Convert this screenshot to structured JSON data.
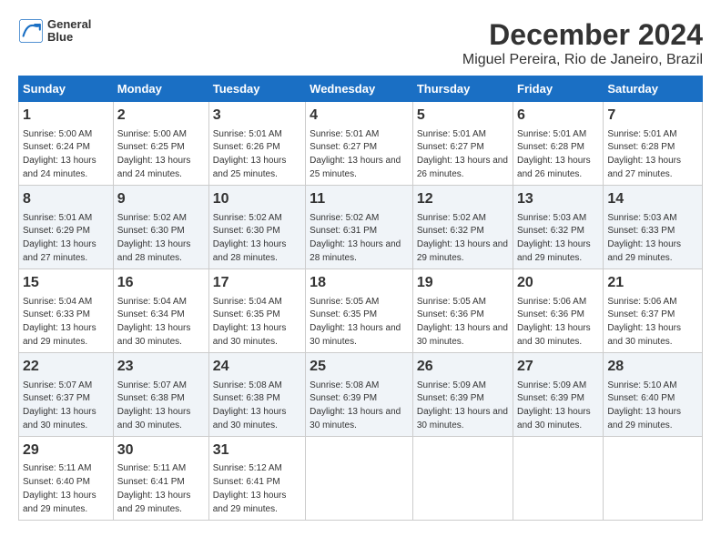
{
  "logo": {
    "line1": "General",
    "line2": "Blue"
  },
  "title": "December 2024",
  "subtitle": "Miguel Pereira, Rio de Janeiro, Brazil",
  "days_header": [
    "Sunday",
    "Monday",
    "Tuesday",
    "Wednesday",
    "Thursday",
    "Friday",
    "Saturday"
  ],
  "weeks": [
    [
      {
        "day": "1",
        "sunrise": "5:00 AM",
        "sunset": "6:24 PM",
        "daylight": "13 hours and 24 minutes."
      },
      {
        "day": "2",
        "sunrise": "5:00 AM",
        "sunset": "6:25 PM",
        "daylight": "13 hours and 24 minutes."
      },
      {
        "day": "3",
        "sunrise": "5:01 AM",
        "sunset": "6:26 PM",
        "daylight": "13 hours and 25 minutes."
      },
      {
        "day": "4",
        "sunrise": "5:01 AM",
        "sunset": "6:27 PM",
        "daylight": "13 hours and 25 minutes."
      },
      {
        "day": "5",
        "sunrise": "5:01 AM",
        "sunset": "6:27 PM",
        "daylight": "13 hours and 26 minutes."
      },
      {
        "day": "6",
        "sunrise": "5:01 AM",
        "sunset": "6:28 PM",
        "daylight": "13 hours and 26 minutes."
      },
      {
        "day": "7",
        "sunrise": "5:01 AM",
        "sunset": "6:28 PM",
        "daylight": "13 hours and 27 minutes."
      }
    ],
    [
      {
        "day": "8",
        "sunrise": "5:01 AM",
        "sunset": "6:29 PM",
        "daylight": "13 hours and 27 minutes."
      },
      {
        "day": "9",
        "sunrise": "5:02 AM",
        "sunset": "6:30 PM",
        "daylight": "13 hours and 28 minutes."
      },
      {
        "day": "10",
        "sunrise": "5:02 AM",
        "sunset": "6:30 PM",
        "daylight": "13 hours and 28 minutes."
      },
      {
        "day": "11",
        "sunrise": "5:02 AM",
        "sunset": "6:31 PM",
        "daylight": "13 hours and 28 minutes."
      },
      {
        "day": "12",
        "sunrise": "5:02 AM",
        "sunset": "6:32 PM",
        "daylight": "13 hours and 29 minutes."
      },
      {
        "day": "13",
        "sunrise": "5:03 AM",
        "sunset": "6:32 PM",
        "daylight": "13 hours and 29 minutes."
      },
      {
        "day": "14",
        "sunrise": "5:03 AM",
        "sunset": "6:33 PM",
        "daylight": "13 hours and 29 minutes."
      }
    ],
    [
      {
        "day": "15",
        "sunrise": "5:04 AM",
        "sunset": "6:33 PM",
        "daylight": "13 hours and 29 minutes."
      },
      {
        "day": "16",
        "sunrise": "5:04 AM",
        "sunset": "6:34 PM",
        "daylight": "13 hours and 30 minutes."
      },
      {
        "day": "17",
        "sunrise": "5:04 AM",
        "sunset": "6:35 PM",
        "daylight": "13 hours and 30 minutes."
      },
      {
        "day": "18",
        "sunrise": "5:05 AM",
        "sunset": "6:35 PM",
        "daylight": "13 hours and 30 minutes."
      },
      {
        "day": "19",
        "sunrise": "5:05 AM",
        "sunset": "6:36 PM",
        "daylight": "13 hours and 30 minutes."
      },
      {
        "day": "20",
        "sunrise": "5:06 AM",
        "sunset": "6:36 PM",
        "daylight": "13 hours and 30 minutes."
      },
      {
        "day": "21",
        "sunrise": "5:06 AM",
        "sunset": "6:37 PM",
        "daylight": "13 hours and 30 minutes."
      }
    ],
    [
      {
        "day": "22",
        "sunrise": "5:07 AM",
        "sunset": "6:37 PM",
        "daylight": "13 hours and 30 minutes."
      },
      {
        "day": "23",
        "sunrise": "5:07 AM",
        "sunset": "6:38 PM",
        "daylight": "13 hours and 30 minutes."
      },
      {
        "day": "24",
        "sunrise": "5:08 AM",
        "sunset": "6:38 PM",
        "daylight": "13 hours and 30 minutes."
      },
      {
        "day": "25",
        "sunrise": "5:08 AM",
        "sunset": "6:39 PM",
        "daylight": "13 hours and 30 minutes."
      },
      {
        "day": "26",
        "sunrise": "5:09 AM",
        "sunset": "6:39 PM",
        "daylight": "13 hours and 30 minutes."
      },
      {
        "day": "27",
        "sunrise": "5:09 AM",
        "sunset": "6:39 PM",
        "daylight": "13 hours and 30 minutes."
      },
      {
        "day": "28",
        "sunrise": "5:10 AM",
        "sunset": "6:40 PM",
        "daylight": "13 hours and 29 minutes."
      }
    ],
    [
      {
        "day": "29",
        "sunrise": "5:11 AM",
        "sunset": "6:40 PM",
        "daylight": "13 hours and 29 minutes."
      },
      {
        "day": "30",
        "sunrise": "5:11 AM",
        "sunset": "6:41 PM",
        "daylight": "13 hours and 29 minutes."
      },
      {
        "day": "31",
        "sunrise": "5:12 AM",
        "sunset": "6:41 PM",
        "daylight": "13 hours and 29 minutes."
      },
      null,
      null,
      null,
      null
    ]
  ]
}
